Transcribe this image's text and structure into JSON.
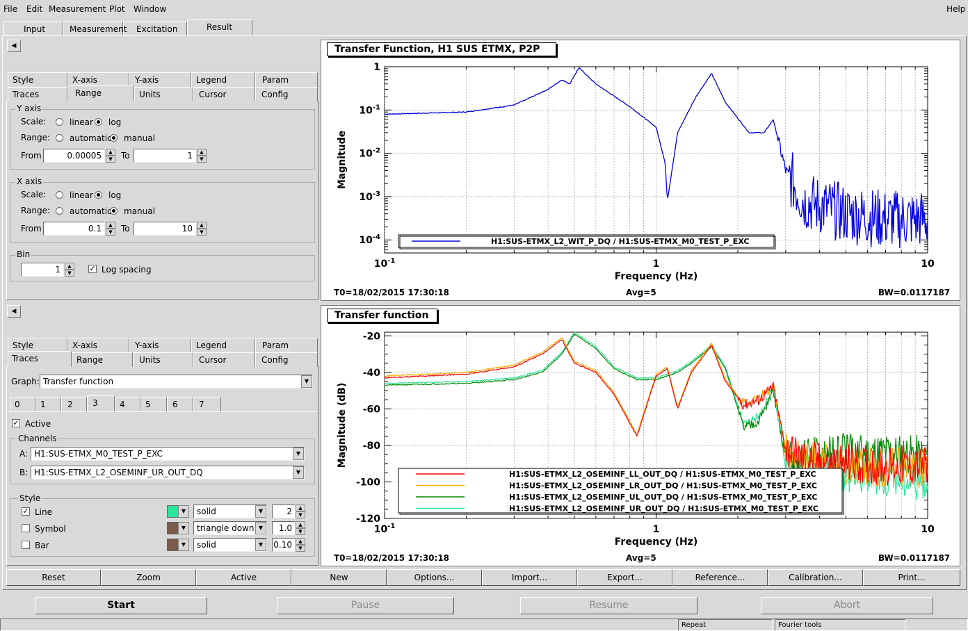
{
  "menu": {
    "file": "File",
    "edit": "Edit",
    "measurement": "Measurement",
    "plot": "Plot",
    "window": "Window",
    "help": "Help"
  },
  "main_tabs": [
    "Input",
    "Measurement",
    "Excitation",
    "Result"
  ],
  "panel1": {
    "tabs_row1": [
      "Style",
      "X-axis",
      "Y-axis",
      "Legend",
      "Param"
    ],
    "tabs_row2": [
      "Traces",
      "Range",
      "Units",
      "Cursor",
      "Config"
    ],
    "yaxis": {
      "title": "Y axis",
      "scale_label": "Scale:",
      "linear": "linear",
      "log": "log",
      "range_label": "Range:",
      "automatic": "automatic",
      "manual": "manual",
      "from_label": "From",
      "from": "0.00005",
      "to_label": "To",
      "to": "1"
    },
    "xaxis": {
      "title": "X axis",
      "scale_label": "Scale:",
      "linear": "linear",
      "log": "log",
      "range_label": "Range:",
      "automatic": "automatic",
      "manual": "manual",
      "from_label": "From",
      "from": "0.1",
      "to_label": "To",
      "to": "10"
    },
    "bin": {
      "title": "Bin",
      "value": "1",
      "log_spacing": "Log spacing"
    }
  },
  "panel2": {
    "tabs_row1": [
      "Style",
      "X-axis",
      "Y-axis",
      "Legend",
      "Param"
    ],
    "tabs_row2": [
      "Traces",
      "Range",
      "Units",
      "Cursor",
      "Config"
    ],
    "graph_label": "Graph:",
    "graph_value": "Transfer function",
    "trace_tabs": [
      "0",
      "1",
      "2",
      "3",
      "4",
      "5",
      "6",
      "7"
    ],
    "active": "Active",
    "channels_title": "Channels",
    "a_label": "A:",
    "a_value": "H1:SUS-ETMX_M0_TEST_P_EXC",
    "b_label": "B:",
    "b_value": "H1:SUS-ETMX_L2_OSEMINF_UR_OUT_DQ",
    "style_title": "Style",
    "line": {
      "label": "Line",
      "style": "solid",
      "width": "2",
      "color": "#2ee39a"
    },
    "symbol": {
      "label": "Symbol",
      "style": "triangle down",
      "size": "1.0",
      "color": "#7a5a48"
    },
    "bar": {
      "label": "Bar",
      "style": "solid",
      "width": "0.10",
      "color": "#7a5a48"
    }
  },
  "plot1": {
    "title": "Transfer Function, H1 SUS ETMX, P2P",
    "ylabel": "Magnitude",
    "xlabel": "Frequency (Hz)",
    "t0": "T0=18/02/2015 17:30:18",
    "avg": "Avg=5",
    "bw": "BW=0.0117187",
    "legend": "H1:SUS-ETMX_L2_WIT_P_DQ / H1:SUS-ETMX_M0_TEST_P_EXC",
    "yticks": [
      {
        "base": "10",
        "exp": "-4",
        "v": -4
      },
      {
        "base": "10",
        "exp": "-3",
        "v": -3
      },
      {
        "base": "10",
        "exp": "-2",
        "v": -2
      },
      {
        "base": "10",
        "exp": "-1",
        "v": -1
      },
      {
        "base": "1",
        "exp": "",
        "v": 0
      }
    ],
    "xticks": [
      {
        "base": "10",
        "exp": "-1",
        "v": -1
      },
      {
        "base": "1",
        "exp": "",
        "v": 0
      },
      {
        "base": "10",
        "exp": "",
        "v": 1
      }
    ]
  },
  "plot2": {
    "title": "Transfer function",
    "ylabel": "Magnitude (dB)",
    "xlabel": "Frequency (Hz)",
    "t0": "T0=18/02/2015 17:30:18",
    "avg": "Avg=5",
    "bw": "BW=0.0117187",
    "legend": [
      "H1:SUS-ETMX_L2_OSEMINF_LL_OUT_DQ / H1:SUS-ETMX_M0_TEST_P_EXC",
      "H1:SUS-ETMX_L2_OSEMINF_LR_OUT_DQ / H1:SUS-ETMX_M0_TEST_P_EXC",
      "H1:SUS-ETMX_L2_OSEMINF_UL_OUT_DQ / H1:SUS-ETMX_M0_TEST_P_EXC",
      "H1:SUS-ETMX_L2_OSEMINF_UR_OUT_DQ / H1:SUS-ETMX_M0_TEST_P_EXC"
    ],
    "yticks": [
      "-20",
      "-40",
      "-60",
      "-80",
      "-100",
      "-120"
    ],
    "xticks": [
      {
        "base": "10",
        "exp": "-1"
      },
      {
        "base": "1",
        "exp": ""
      },
      {
        "base": "10",
        "exp": ""
      }
    ]
  },
  "chart_data": [
    {
      "type": "line",
      "title": "Transfer Function, H1 SUS ETMX, P2P",
      "xlabel": "Frequency (Hz)",
      "ylabel": "Magnitude",
      "xscale": "log",
      "yscale": "log",
      "xlim": [
        0.1,
        10
      ],
      "ylim": [
        5e-05,
        1
      ],
      "grid": true,
      "legend": "bottom-center",
      "series": [
        {
          "name": "H1:SUS-ETMX_L2_WIT_P_DQ / H1:SUS-ETMX_M0_TEST_P_EXC",
          "color": "#0000dd",
          "x": [
            0.1,
            0.2,
            0.3,
            0.4,
            0.45,
            0.48,
            0.52,
            0.6,
            0.8,
            1.0,
            1.08,
            1.1,
            1.2,
            1.4,
            1.6,
            1.8,
            2.2,
            2.5,
            2.7,
            3.0,
            3.5,
            5,
            7,
            10
          ],
          "y": [
            0.08,
            0.09,
            0.13,
            0.3,
            0.5,
            0.4,
            0.95,
            0.4,
            0.12,
            0.04,
            0.006,
            0.0008,
            0.03,
            0.2,
            0.7,
            0.15,
            0.03,
            0.03,
            0.06,
            0.004,
            0.0008,
            0.0004,
            0.0003,
            0.0003
          ]
        }
      ]
    },
    {
      "type": "line",
      "title": "Transfer function",
      "xlabel": "Frequency (Hz)",
      "ylabel": "Magnitude (dB)",
      "xscale": "log",
      "xlim": [
        0.1,
        10
      ],
      "ylim": [
        -120,
        -18
      ],
      "grid": true,
      "legend": "bottom-right",
      "x": [
        0.1,
        0.2,
        0.3,
        0.38,
        0.45,
        0.5,
        0.6,
        0.7,
        0.85,
        1.0,
        1.1,
        1.2,
        1.35,
        1.6,
        1.8,
        2.1,
        2.4,
        2.7,
        3.0,
        3.5,
        5,
        7,
        10
      ],
      "series": [
        {
          "name": "H1:SUS-ETMX_L2_OSEMINF_LL_OUT_DQ / H1:SUS-ETMX_M0_TEST_P_EXC",
          "color": "#ff0000",
          "y": [
            -43,
            -41,
            -37,
            -30,
            -22,
            -35,
            -40,
            -52,
            -75,
            -42,
            -38,
            -60,
            -40,
            -25,
            -45,
            -58,
            -55,
            -48,
            -82,
            -88,
            -90,
            -91,
            -92
          ]
        },
        {
          "name": "H1:SUS-ETMX_L2_OSEMINF_LR_OUT_DQ / H1:SUS-ETMX_M0_TEST_P_EXC",
          "color": "#ffaa00",
          "y": [
            -42,
            -40,
            -36,
            -29,
            -21,
            -34,
            -39,
            -51,
            -74,
            -41,
            -37,
            -59,
            -39,
            -24,
            -44,
            -57,
            -54,
            -47,
            -83,
            -89,
            -91,
            -92,
            -93
          ]
        },
        {
          "name": "H1:SUS-ETMX_L2_OSEMINF_UL_OUT_DQ / H1:SUS-ETMX_M0_TEST_P_EXC",
          "color": "#008800",
          "y": [
            -47,
            -46,
            -44,
            -40,
            -30,
            -19,
            -27,
            -38,
            -44,
            -44,
            -42,
            -40,
            -35,
            -26,
            -38,
            -70,
            -66,
            -50,
            -88,
            -85,
            -84,
            -83,
            -85
          ]
        },
        {
          "name": "H1:SUS-ETMX_L2_OSEMINF_UR_OUT_DQ / H1:SUS-ETMX_M0_TEST_P_EXC",
          "color": "#2ee39a",
          "y": [
            -46,
            -45,
            -43,
            -39,
            -29,
            -18,
            -26,
            -37,
            -43,
            -43,
            -41,
            -39,
            -34,
            -25,
            -37,
            -68,
            -64,
            -49,
            -90,
            -92,
            -95,
            -97,
            -100
          ]
        }
      ]
    }
  ],
  "bottom_buttons": [
    "Reset",
    "Zoom",
    "Active",
    "New",
    "Options...",
    "Import...",
    "Export...",
    "Reference...",
    "Calibration...",
    "Print..."
  ],
  "run_buttons": [
    "Start",
    "Pause",
    "Resume",
    "Abort"
  ],
  "status": [
    "Repeat",
    "Fourier tools"
  ]
}
